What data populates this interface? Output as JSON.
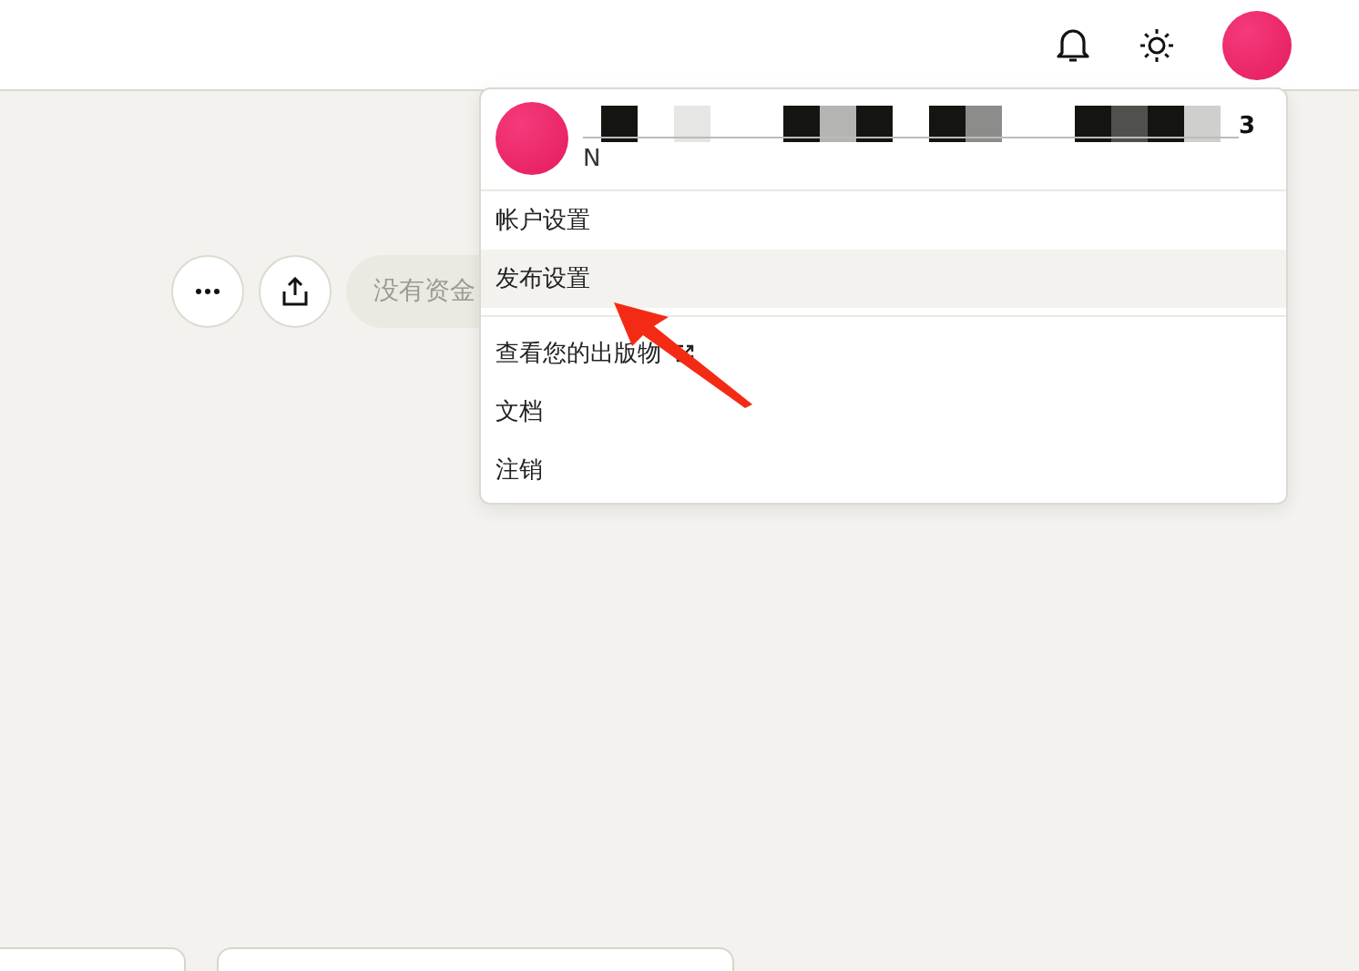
{
  "topbar": {
    "icons": [
      {
        "kind": "bell"
      },
      {
        "kind": "sun"
      },
      {
        "kind": "avatar"
      }
    ]
  },
  "actions": {
    "pill_text": "没有资金"
  },
  "menu": {
    "name_tail": "3",
    "email_head": "N",
    "items": [
      {
        "label": "帐户设置",
        "selected": false,
        "external": false
      },
      {
        "label": "发布设置",
        "selected": true,
        "external": false
      },
      {
        "label": "查看您的出版物",
        "selected": false,
        "external": true
      },
      {
        "label": "文档",
        "selected": false,
        "external": false
      },
      {
        "label": "注销",
        "selected": false,
        "external": false
      }
    ]
  }
}
